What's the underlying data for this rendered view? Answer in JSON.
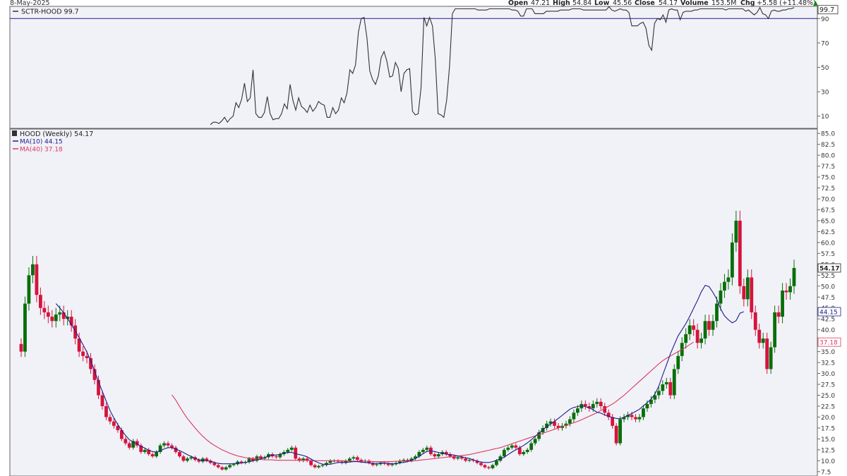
{
  "header": {
    "date": "8-May-2025",
    "open_label": "Open",
    "open": "47.21",
    "high_label": "High",
    "high": "54.84",
    "low_label": "Low",
    "low": "45.56",
    "close_label": "Close",
    "close": "54.17",
    "volume_label": "Volume",
    "volume": "153.5M",
    "chg_label": "Chg",
    "chg": "+5.58 (+11.48%)"
  },
  "colors": {
    "panel_bg": "#f1f1f8",
    "up": "#0a6e0a",
    "down": "#d4143c",
    "ma10": "#1c1c8c",
    "ma40": "#d93a5a",
    "sctr_line": "#333333",
    "sctr_threshold": "#1c1c8c"
  },
  "chart_data": [
    {
      "type": "line",
      "title": "SCTR-HOOD 99.7",
      "y_ticks": [
        "90",
        "70",
        "50",
        "30",
        "10"
      ],
      "ylim": [
        0,
        100
      ],
      "threshold": 90,
      "last_value_label": "99.7",
      "series": [
        {
          "name": "SCTR-HOOD",
          "values": [
            3,
            5,
            5,
            4,
            6,
            9,
            5,
            8,
            10,
            21,
            17,
            24,
            37,
            22,
            25,
            48,
            12,
            9,
            9,
            13,
            26,
            12,
            7,
            8,
            8,
            12,
            20,
            16,
            36,
            23,
            15,
            25,
            18,
            16,
            13,
            19,
            14,
            17,
            22,
            20,
            19,
            9,
            9,
            17,
            12,
            15,
            25,
            21,
            29,
            48,
            45,
            52,
            79,
            90,
            91,
            74,
            47,
            40,
            36,
            43,
            58,
            63,
            55,
            42,
            43,
            54,
            49,
            30,
            45,
            48,
            49,
            14,
            11,
            12,
            33,
            91,
            84,
            91,
            84,
            57,
            12,
            11,
            9,
            23,
            51,
            94,
            98,
            98,
            98,
            98,
            98,
            98,
            98,
            98,
            97,
            97,
            97,
            97,
            98,
            98,
            98,
            98,
            98,
            98,
            98,
            98,
            97,
            97,
            96,
            92,
            92,
            98,
            98,
            98,
            94,
            94,
            94,
            94,
            96,
            96,
            96,
            96,
            96,
            97,
            97,
            97,
            97,
            98,
            98,
            98,
            98,
            97,
            97,
            97,
            97,
            97,
            97,
            97,
            97,
            97,
            99.7,
            97,
            96,
            97,
            98,
            97,
            97,
            95,
            84,
            84,
            84,
            86,
            87,
            82,
            68,
            64,
            86,
            90,
            89,
            93,
            87,
            97,
            98,
            97,
            97,
            89,
            95,
            96,
            96,
            96,
            97,
            97,
            98,
            98,
            98,
            98,
            98,
            98,
            98,
            98,
            98,
            97,
            98,
            98,
            98,
            98,
            98,
            98,
            96,
            97,
            95,
            93,
            95,
            99,
            94,
            93,
            90,
            96,
            97,
            96,
            96,
            97,
            97,
            98,
            98,
            99
          ]
        }
      ]
    },
    {
      "type": "candlestick",
      "title": "HOOD (Weekly) 54.17",
      "legend": [
        {
          "name": "MA(10)",
          "value": "44.15"
        },
        {
          "name": "MA(40)",
          "value": "37.18"
        }
      ],
      "y_ticks": [
        "85.0",
        "82.5",
        "80.0",
        "77.5",
        "75.0",
        "72.5",
        "70.0",
        "67.5",
        "65.0",
        "62.5",
        "60.0",
        "57.5",
        "55.0",
        "52.5",
        "50.0",
        "47.5",
        "45.0",
        "42.5",
        "40.0",
        "37.5",
        "35.0",
        "32.5",
        "30.0",
        "27.5",
        "25.0",
        "22.5",
        "20.0",
        "17.5",
        "15.0",
        "12.5",
        "10.0",
        "7.5"
      ],
      "ylim": [
        6.5,
        86
      ],
      "price_labels": [
        {
          "name": "close",
          "value": "54.17"
        },
        {
          "name": "ma10",
          "value": "44.15"
        },
        {
          "name": "ma40",
          "value": "37.18"
        }
      ],
      "close": [
        35.0,
        46.0,
        52.5,
        55.0,
        48.0,
        45.0,
        44.0,
        43.0,
        42.0,
        43.5,
        44.0,
        42.5,
        43.0,
        41.0,
        38.0,
        35.0,
        34.0,
        33.5,
        31.0,
        28.5,
        25.0,
        22.5,
        20.0,
        19.0,
        18.0,
        17.0,
        15.0,
        14.0,
        13.0,
        14.5,
        13.5,
        12.0,
        12.5,
        11.5,
        11.0,
        12.0,
        13.5,
        14.0,
        13.5,
        13.0,
        12.0,
        11.0,
        10.0,
        10.5,
        10.8,
        10.2,
        9.8,
        10.5,
        10.0,
        9.5,
        9.0,
        8.5,
        8.0,
        8.5,
        9.0,
        9.2,
        9.8,
        9.5,
        9.7,
        10.5,
        10.0,
        11.0,
        10.5,
        10.8,
        11.5,
        11.0,
        10.8,
        11.5,
        12.0,
        12.5,
        13.0,
        10.5,
        10.0,
        10.5,
        10.0,
        9.0,
        8.5,
        8.8,
        9.0,
        9.5,
        10.0,
        10.0,
        9.8,
        9.5,
        10.0,
        10.5,
        10.8,
        10.2,
        9.8,
        10.0,
        9.5,
        9.0,
        9.2,
        9.5,
        9.3,
        9.0,
        9.2,
        9.5,
        10.0,
        10.2,
        10.0,
        10.5,
        11.0,
        12.0,
        12.5,
        13.0,
        11.5,
        11.0,
        11.5,
        12.0,
        11.5,
        11.0,
        10.5,
        10.8,
        10.5,
        10.0,
        10.2,
        10.0,
        9.5,
        9.0,
        8.5,
        8.3,
        9.0,
        10.0,
        11.0,
        12.5,
        13.0,
        13.5,
        13.0,
        11.5,
        12.0,
        12.5,
        14.0,
        15.0,
        16.5,
        17.5,
        18.5,
        19.0,
        18.0,
        17.5,
        18.0,
        18.5,
        19.5,
        21.0,
        22.0,
        23.0,
        22.5,
        22.0,
        23.0,
        23.5,
        22.5,
        21.0,
        20.0,
        18.0,
        14.0,
        19.5,
        20.0,
        20.5,
        20.0,
        19.5,
        20.0,
        22.0,
        23.0,
        24.0,
        25.0,
        26.0,
        27.5,
        28.0,
        25.0,
        31.0,
        34.0,
        37.0,
        39.0,
        41.0,
        40.0,
        37.0,
        38.0,
        42.0,
        40.0,
        42.0,
        46.0,
        49.0,
        51.0,
        52.0,
        60.0,
        65.0,
        50.0,
        47.0,
        52.0,
        44.0,
        40.0,
        37.0,
        38.0,
        31.0,
        36.0,
        44.0,
        43.0,
        49.0,
        48.6,
        50.0,
        54.17
      ],
      "ma10": [
        null,
        null,
        null,
        null,
        null,
        null,
        null,
        null,
        null,
        46.0,
        45.0,
        43.9,
        42.6,
        41.2,
        39.7,
        38.2,
        36.6,
        34.9,
        32.9,
        30.6,
        28.1,
        25.9,
        23.7,
        21.5,
        19.8,
        18.3,
        17.0,
        15.8,
        14.8,
        14.3,
        13.8,
        13.3,
        12.9,
        12.4,
        12.1,
        12.0,
        12.3,
        12.7,
        13.0,
        13.0,
        12.7,
        12.3,
        11.9,
        11.4,
        11.0,
        10.6,
        10.2,
        10.1,
        10.0,
        9.9,
        9.6,
        9.4,
        9.3,
        9.3,
        9.3,
        9.3,
        9.4,
        9.5,
        9.6,
        9.8,
        10.0,
        10.2,
        10.4,
        10.7,
        11.1,
        11.3,
        11.3,
        11.5,
        11.7,
        11.9,
        11.9,
        11.6,
        11.4,
        11.2,
        10.9,
        10.4,
        9.9,
        9.5,
        9.2,
        9.2,
        9.2,
        9.4,
        9.6,
        9.6,
        9.6,
        9.7,
        9.8,
        9.8,
        9.7,
        9.6,
        9.5,
        9.4,
        9.4,
        9.5,
        9.5,
        9.4,
        9.3,
        9.3,
        9.5,
        9.6,
        9.8,
        10.1,
        10.5,
        11.0,
        11.6,
        12.1,
        12.3,
        12.1,
        11.9,
        11.7,
        11.5,
        11.4,
        11.3,
        11.1,
        10.9,
        10.7,
        10.5,
        10.2,
        9.9,
        9.7,
        9.6,
        9.6,
        9.8,
        10.1,
        10.4,
        10.8,
        11.4,
        12.0,
        12.5,
        13.0,
        13.5,
        14.1,
        14.8,
        15.6,
        16.3,
        17.1,
        17.8,
        18.4,
        19.0,
        19.7,
        20.4,
        21.1,
        21.8,
        22.2,
        22.4,
        22.6,
        22.4,
        22.1,
        21.7,
        21.1,
        20.9,
        20.5,
        20.2,
        19.9,
        19.7,
        19.6,
        20.0,
        20.4,
        20.8,
        21.3,
        21.8,
        22.6,
        23.3,
        24.1,
        25.3,
        27.1,
        29.6,
        32.0,
        34.5,
        36.6,
        38.6,
        40.0,
        41.4,
        43.1,
        44.9,
        46.7,
        48.7,
        50.2,
        49.9,
        48.6,
        47.0,
        44.8,
        43.2,
        42.3,
        41.6,
        42.1,
        43.8,
        44.15
      ],
      "ma40": [
        null,
        null,
        null,
        null,
        null,
        null,
        null,
        null,
        null,
        null,
        null,
        null,
        null,
        null,
        null,
        null,
        null,
        null,
        null,
        null,
        null,
        null,
        null,
        null,
        null,
        null,
        null,
        null,
        null,
        null,
        null,
        null,
        null,
        null,
        null,
        null,
        null,
        null,
        null,
        25.1,
        23.9,
        22.4,
        21.0,
        19.7,
        18.6,
        17.5,
        16.5,
        15.6,
        14.8,
        14.1,
        13.5,
        13.0,
        12.5,
        12.1,
        11.7,
        11.4,
        11.1,
        10.9,
        10.7,
        10.6,
        10.5,
        10.4,
        10.3,
        10.2,
        10.2,
        10.2,
        10.1,
        10.1,
        10.1,
        10.1,
        10.1,
        10.1,
        10.1,
        10.1,
        10.1,
        10.0,
        10.0,
        10.0,
        10.0,
        10.0,
        10.0,
        10.0,
        10.0,
        10.0,
        9.95,
        9.9,
        9.9,
        9.9,
        9.9,
        9.9,
        9.9,
        9.8,
        9.8,
        9.8,
        9.8,
        9.8,
        9.8,
        9.9,
        9.9,
        9.9,
        9.9,
        9.9,
        10.0,
        10.1,
        10.2,
        10.3,
        10.4,
        10.5,
        10.6,
        10.7,
        10.8,
        10.9,
        11.0,
        11.1,
        11.2,
        11.3,
        11.4,
        11.6,
        11.8,
        12.0,
        12.2,
        12.4,
        12.6,
        12.8,
        13.0,
        13.3,
        13.6,
        13.9,
        14.2,
        14.5,
        14.8,
        15.1,
        15.4,
        15.7,
        16.0,
        16.3,
        16.6,
        16.9,
        17.2,
        17.5,
        17.8,
        18.1,
        18.4,
        18.7,
        19.0,
        19.4,
        19.8,
        20.2,
        20.6,
        21.0,
        21.5,
        22.0,
        22.5,
        23.0,
        23.6,
        24.3,
        25.0,
        25.8,
        26.6,
        27.4,
        28.2,
        29.0,
        29.8,
        30.6,
        31.4,
        32.2,
        32.9,
        33.5,
        34.0,
        34.5,
        35.0,
        35.5,
        36.0,
        36.6,
        37.18
      ]
    }
  ]
}
